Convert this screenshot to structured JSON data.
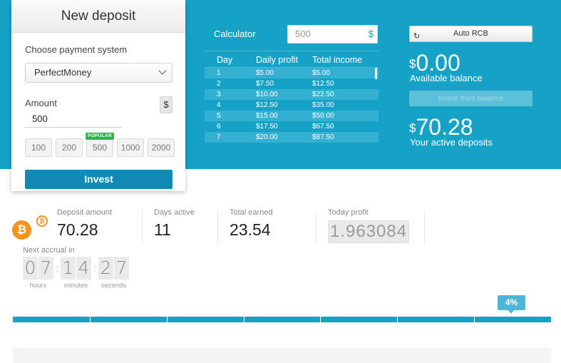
{
  "deposit": {
    "title": "New deposit",
    "payment_label": "Choose payment system",
    "payment_value": "PerfectMoney",
    "amount_label": "Amount",
    "amount_value": "500",
    "currency_symbol": "$",
    "presets": [
      "100",
      "200",
      "500",
      "1000",
      "2000"
    ],
    "popular_badge": "POPULAR",
    "invest_label": "Invest"
  },
  "calculator": {
    "label": "Calculator",
    "input_value": "500",
    "currency_symbol": "$",
    "headers": [
      "Day",
      "Daily profit",
      "Total income"
    ],
    "rows": [
      [
        "1",
        "$5.00",
        "$5.00"
      ],
      [
        "2",
        "$7.50",
        "$12.50"
      ],
      [
        "3",
        "$10.00",
        "$22.50"
      ],
      [
        "4",
        "$12.50",
        "$35.00"
      ],
      [
        "5",
        "$15.00",
        "$50.00"
      ],
      [
        "6",
        "$17.50",
        "$67.50"
      ],
      [
        "7",
        "$20.00",
        "$87.50"
      ]
    ]
  },
  "account": {
    "auto_rcb_label": "Auto RCB",
    "balance_currency": "$",
    "balance_value": "0.00",
    "balance_caption": "Available balance",
    "invest_from_balance_label": "Invest from balance",
    "deposits_currency": "$",
    "deposits_value": "70.28",
    "deposits_caption": "Your active deposits"
  },
  "stats": {
    "deposit_amount_label": "Deposit amount",
    "deposit_amount_value": "70.28",
    "days_active_label": "Days active",
    "days_active_value": "11",
    "total_earned_label": "Total earned",
    "total_earned_value": "23.54",
    "today_profit_label": "Today profit",
    "today_profit_value": "1.963084"
  },
  "timer": {
    "label": "Next accrual in",
    "hours": [
      "0",
      "7"
    ],
    "minutes": [
      "1",
      "4"
    ],
    "seconds": [
      "2",
      "7"
    ],
    "hours_label": "hours",
    "minutes_label": "minutes",
    "seconds_label": "seconds"
  },
  "progress": {
    "percent_label": "4%",
    "segments": 7
  },
  "colors": {
    "brand_blue": "#16a2c6",
    "button_blue": "#138ab6",
    "bitcoin_orange": "#f4921a",
    "popular_green": "#2fb34a"
  },
  "icons": {
    "coin": "bitcoin-icon",
    "refresh": "refresh-icon",
    "dropdown": "chevron-down-icon"
  }
}
